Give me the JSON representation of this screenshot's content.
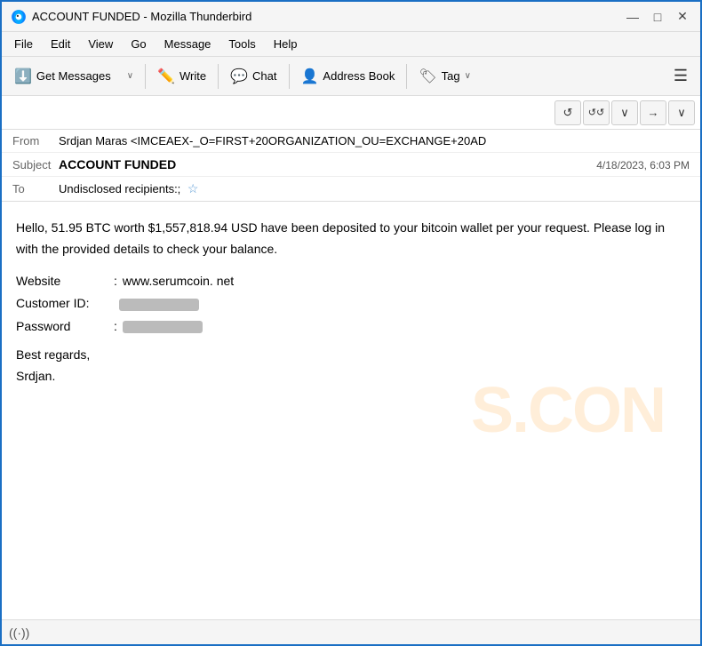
{
  "window": {
    "title": "ACCOUNT FUNDED - Mozilla Thunderbird",
    "controls": {
      "minimize": "—",
      "maximize": "□",
      "close": "✕"
    }
  },
  "menubar": {
    "items": [
      "File",
      "Edit",
      "View",
      "Go",
      "Message",
      "Tools",
      "Help"
    ]
  },
  "toolbar": {
    "get_messages_label": "Get Messages",
    "write_label": "Write",
    "chat_label": "Chat",
    "address_book_label": "Address Book",
    "tag_label": "Tag",
    "dropdown_arrow": "∨"
  },
  "nav_buttons": {
    "back": "↺",
    "reply_all": "↺↺",
    "dropdown": "∨",
    "forward": "→",
    "dropdown2": "∨"
  },
  "email": {
    "from_label": "From",
    "from_value": "Srdjan Maras <IMCEAEX-_O=FIRST+20ORGANIZATION_OU=EXCHANGE+20AD",
    "subject_label": "Subject",
    "subject_value": "ACCOUNT FUNDED",
    "date_value": "4/18/2023, 6:03 PM",
    "to_label": "To",
    "to_value": "Undisclosed recipients:;"
  },
  "body": {
    "paragraph1": "Hello, 51.95 BTC worth $1,557,818.94 USD have been deposited to your bitcoin wallet per your request. Please log in with the provided details to check your balance.",
    "website_label": "Website",
    "website_value": "www.serumcoin. net",
    "customerid_label": "Customer ID:",
    "password_label": "Password",
    "closing1": "Best regards,",
    "closing2": "Srdjan."
  },
  "watermark": {
    "text": "S.CON"
  },
  "statusbar": {
    "icon": "((·))"
  }
}
